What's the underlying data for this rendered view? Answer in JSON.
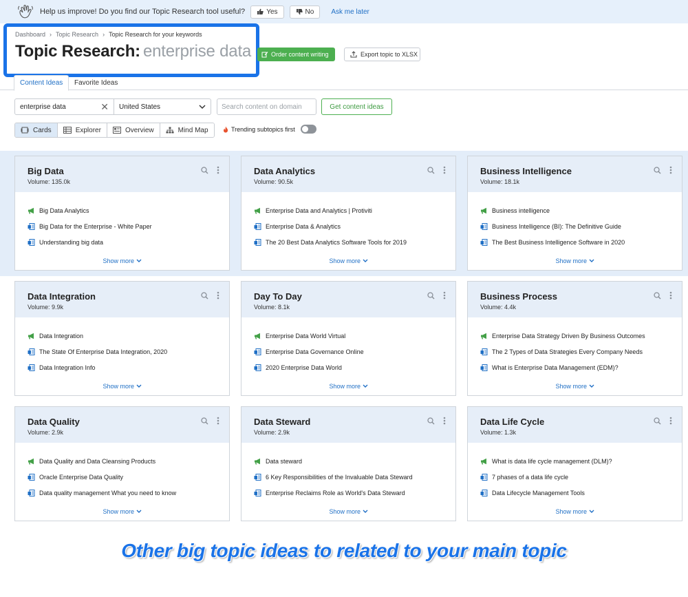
{
  "feedback": {
    "question": "Help us improve! Do you find our Topic Research tool useful?",
    "yes_label": "Yes",
    "no_label": "No",
    "later_label": "Ask me later"
  },
  "breadcrumb": [
    "Dashboard",
    "Topic Research",
    "Topic Research for your keywords"
  ],
  "header": {
    "title": "Topic Research:",
    "keyword": "enterprise data",
    "order_label": "Order content writing",
    "export_label": "Export topic to XLSX"
  },
  "tabs": [
    {
      "label": "Content Ideas",
      "active": true
    },
    {
      "label": "Favorite Ideas",
      "active": false
    }
  ],
  "controls": {
    "keyword_value": "enterprise data",
    "country_value": "United States",
    "domain_placeholder": "Search content on domain",
    "get_ideas_label": "Get content ideas",
    "trending_label": "Trending subtopics first"
  },
  "views": [
    {
      "label": "Cards",
      "icon": "cards-icon",
      "active": true
    },
    {
      "label": "Explorer",
      "icon": "table-icon",
      "active": false
    },
    {
      "label": "Overview",
      "icon": "overview-icon",
      "active": false
    },
    {
      "label": "Mind Map",
      "icon": "mindmap-icon",
      "active": false
    }
  ],
  "cards": [
    {
      "title": "Big Data",
      "volume": "Volume: 135.0k",
      "ideas": [
        "Big Data Analytics",
        "Big Data for the Enterprise - White Paper",
        "Understanding big data"
      ]
    },
    {
      "title": "Data Analytics",
      "volume": "Volume: 90.5k",
      "ideas": [
        "Enterprise Data and Analytics | Protiviti",
        "Enterprise Data & Analytics",
        "The 20 Best Data Analytics Software Tools for 2019"
      ]
    },
    {
      "title": "Business Intelligence",
      "volume": "Volume: 18.1k",
      "ideas": [
        "Business intelligence",
        "Business Intelligence (BI): The Definitive Guide",
        "The Best Business Intelligence Software in 2020"
      ]
    },
    {
      "title": "Data Integration",
      "volume": "Volume: 9.9k",
      "ideas": [
        "Data Integration",
        "The State Of Enterprise Data Integration, 2020",
        "Data Integration Info"
      ]
    },
    {
      "title": "Day To Day",
      "volume": "Volume: 8.1k",
      "ideas": [
        "Enterprise Data World Virtual",
        "Enterprise Data Governance Online",
        "2020 Enterprise Data World"
      ]
    },
    {
      "title": "Business Process",
      "volume": "Volume: 4.4k",
      "ideas": [
        "Enterprise Data Strategy Driven By Business Outcomes",
        "The 2 Types of Data Strategies Every Company Needs",
        "What is Enterprise Data Management (EDM)?"
      ]
    },
    {
      "title": "Data Quality",
      "volume": "Volume: 2.9k",
      "ideas": [
        "Data Quality and Data Cleansing Products",
        "Oracle Enterprise Data Quality",
        "Data quality management What you need to know"
      ]
    },
    {
      "title": "Data Steward",
      "volume": "Volume: 2.9k",
      "ideas": [
        "Data steward",
        "6 Key Responsibilities of the Invaluable Data Steward",
        "Enterprise Reclaims Role as World's Data Steward"
      ]
    },
    {
      "title": "Data Life Cycle",
      "volume": "Volume: 1.3k",
      "ideas": [
        "What is data life cycle management (DLM)?",
        "7 phases of a data life cycle",
        "Data Lifecycle Management Tools"
      ]
    }
  ],
  "show_more_label": "Show more",
  "caption": "Other big topic ideas to related to your main topic",
  "colors": {
    "accent": "#1a73e8",
    "green": "#4caf50",
    "link": "#1f6fc5"
  }
}
